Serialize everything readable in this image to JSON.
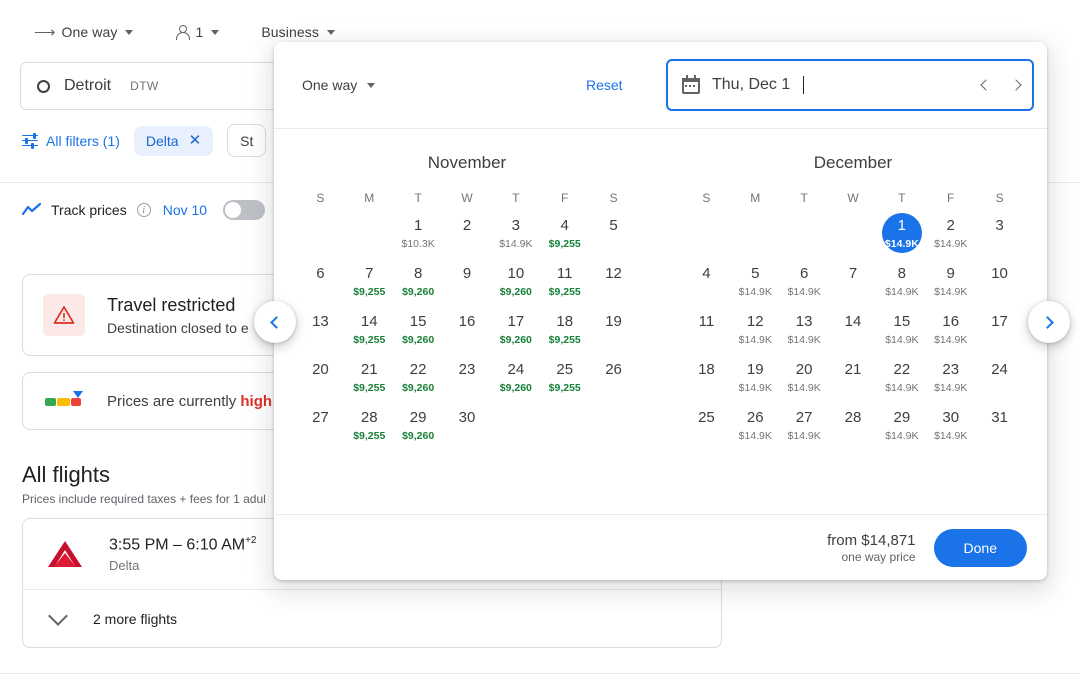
{
  "topbar": {
    "trip_type": "One way",
    "passengers": "1",
    "cabin": "Business",
    "arrow_icon": "arrow-right-icon",
    "person_icon": "person-icon"
  },
  "search": {
    "origin_city": "Detroit",
    "origin_code": "DTW",
    "origin_icon": "circle-icon"
  },
  "filters": {
    "all_filters_label": "All filters (1)",
    "tune_icon": "tune-icon",
    "chips": [
      {
        "label": "Delta",
        "removable": true,
        "close_icon": "close-icon"
      },
      {
        "label": "St",
        "removable": false
      }
    ]
  },
  "track_prices": {
    "label": "Track prices",
    "info_icon": "info-icon",
    "chart_icon": "trend-line-icon",
    "date": "Nov 10",
    "toggle_state": "off"
  },
  "cards": {
    "restricted": {
      "icon": "warning-triangle-icon",
      "title": "Travel restricted",
      "subtitle": "Destination closed to e"
    },
    "price_status": {
      "icon": "price-gauge-icon",
      "text_prefix": "Prices are currently ",
      "text_highlight": "high",
      "highlight_color": "#d93025"
    }
  },
  "all_flights": {
    "heading": "All flights",
    "subheading": "Prices include required taxes + fees for 1 adul",
    "rows": [
      {
        "airline_icon": "delta-logo-icon",
        "time": "3:55 PM – 6:10 AM",
        "day_offset": "+2",
        "airline": "Delta"
      }
    ],
    "more_label": "2 more flights",
    "more_icon": "chevron-down-icon"
  },
  "carousel": {
    "prev_icon": "chevron-left-icon",
    "next_icon": "chevron-right-icon"
  },
  "dialog": {
    "trip_type": "One way",
    "trip_caret_icon": "chevron-down-icon",
    "reset_label": "Reset",
    "date_field": {
      "icon": "calendar-icon",
      "value": "Thu, Dec 1",
      "prev_icon": "chevron-left-icon",
      "next_icon": "chevron-right-icon"
    },
    "dow": [
      "S",
      "M",
      "T",
      "W",
      "T",
      "F",
      "S"
    ],
    "footer": {
      "from_price": "from $14,871",
      "price_note": "one way price",
      "done_label": "Done"
    },
    "accent_color": "#1a73e8",
    "cheap_color": "#188038",
    "normal_price_color": "#70757a",
    "months": [
      {
        "title": "November",
        "lead_blanks": 2,
        "days": [
          {
            "n": "1",
            "price": "$10.3K",
            "cheap": false
          },
          {
            "n": "2",
            "price": "",
            "cheap": false
          },
          {
            "n": "3",
            "price": "$14.9K",
            "cheap": false
          },
          {
            "n": "4",
            "price": "$9,255",
            "cheap": true
          },
          {
            "n": "5",
            "price": "",
            "cheap": false
          },
          {
            "n": "6",
            "price": "",
            "cheap": false
          },
          {
            "n": "7",
            "price": "$9,255",
            "cheap": true
          },
          {
            "n": "8",
            "price": "$9,260",
            "cheap": true
          },
          {
            "n": "9",
            "price": "",
            "cheap": false
          },
          {
            "n": "10",
            "price": "$9,260",
            "cheap": true
          },
          {
            "n": "11",
            "price": "$9,255",
            "cheap": true
          },
          {
            "n": "12",
            "price": "",
            "cheap": false
          },
          {
            "n": "13",
            "price": "",
            "cheap": false
          },
          {
            "n": "14",
            "price": "$9,255",
            "cheap": true
          },
          {
            "n": "15",
            "price": "$9,260",
            "cheap": true
          },
          {
            "n": "16",
            "price": "",
            "cheap": false
          },
          {
            "n": "17",
            "price": "$9,260",
            "cheap": true
          },
          {
            "n": "18",
            "price": "$9,255",
            "cheap": true
          },
          {
            "n": "19",
            "price": "",
            "cheap": false
          },
          {
            "n": "20",
            "price": "",
            "cheap": false
          },
          {
            "n": "21",
            "price": "$9,255",
            "cheap": true
          },
          {
            "n": "22",
            "price": "$9,260",
            "cheap": true
          },
          {
            "n": "23",
            "price": "",
            "cheap": false
          },
          {
            "n": "24",
            "price": "$9,260",
            "cheap": true
          },
          {
            "n": "25",
            "price": "$9,255",
            "cheap": true
          },
          {
            "n": "26",
            "price": "",
            "cheap": false
          },
          {
            "n": "27",
            "price": "",
            "cheap": false
          },
          {
            "n": "28",
            "price": "$9,255",
            "cheap": true
          },
          {
            "n": "29",
            "price": "$9,260",
            "cheap": true
          },
          {
            "n": "30",
            "price": "",
            "cheap": false
          }
        ]
      },
      {
        "title": "December",
        "lead_blanks": 4,
        "days": [
          {
            "n": "1",
            "price": "$14.9K",
            "cheap": false,
            "selected": true
          },
          {
            "n": "2",
            "price": "$14.9K",
            "cheap": false
          },
          {
            "n": "3",
            "price": "",
            "cheap": false
          },
          {
            "n": "4",
            "price": "",
            "cheap": false
          },
          {
            "n": "5",
            "price": "$14.9K",
            "cheap": false
          },
          {
            "n": "6",
            "price": "$14.9K",
            "cheap": false
          },
          {
            "n": "7",
            "price": "",
            "cheap": false
          },
          {
            "n": "8",
            "price": "$14.9K",
            "cheap": false
          },
          {
            "n": "9",
            "price": "$14.9K",
            "cheap": false
          },
          {
            "n": "10",
            "price": "",
            "cheap": false
          },
          {
            "n": "11",
            "price": "",
            "cheap": false
          },
          {
            "n": "12",
            "price": "$14.9K",
            "cheap": false
          },
          {
            "n": "13",
            "price": "$14.9K",
            "cheap": false
          },
          {
            "n": "14",
            "price": "",
            "cheap": false
          },
          {
            "n": "15",
            "price": "$14.9K",
            "cheap": false
          },
          {
            "n": "16",
            "price": "$14.9K",
            "cheap": false
          },
          {
            "n": "17",
            "price": "",
            "cheap": false
          },
          {
            "n": "18",
            "price": "",
            "cheap": false
          },
          {
            "n": "19",
            "price": "$14.9K",
            "cheap": false
          },
          {
            "n": "20",
            "price": "$14.9K",
            "cheap": false
          },
          {
            "n": "21",
            "price": "",
            "cheap": false
          },
          {
            "n": "22",
            "price": "$14.9K",
            "cheap": false
          },
          {
            "n": "23",
            "price": "$14.9K",
            "cheap": false
          },
          {
            "n": "24",
            "price": "",
            "cheap": false
          },
          {
            "n": "25",
            "price": "",
            "cheap": false
          },
          {
            "n": "26",
            "price": "$14.9K",
            "cheap": false
          },
          {
            "n": "27",
            "price": "$14.9K",
            "cheap": false
          },
          {
            "n": "28",
            "price": "",
            "cheap": false
          },
          {
            "n": "29",
            "price": "$14.9K",
            "cheap": false
          },
          {
            "n": "30",
            "price": "$14.9K",
            "cheap": false
          },
          {
            "n": "31",
            "price": "",
            "cheap": false
          }
        ]
      }
    ]
  }
}
